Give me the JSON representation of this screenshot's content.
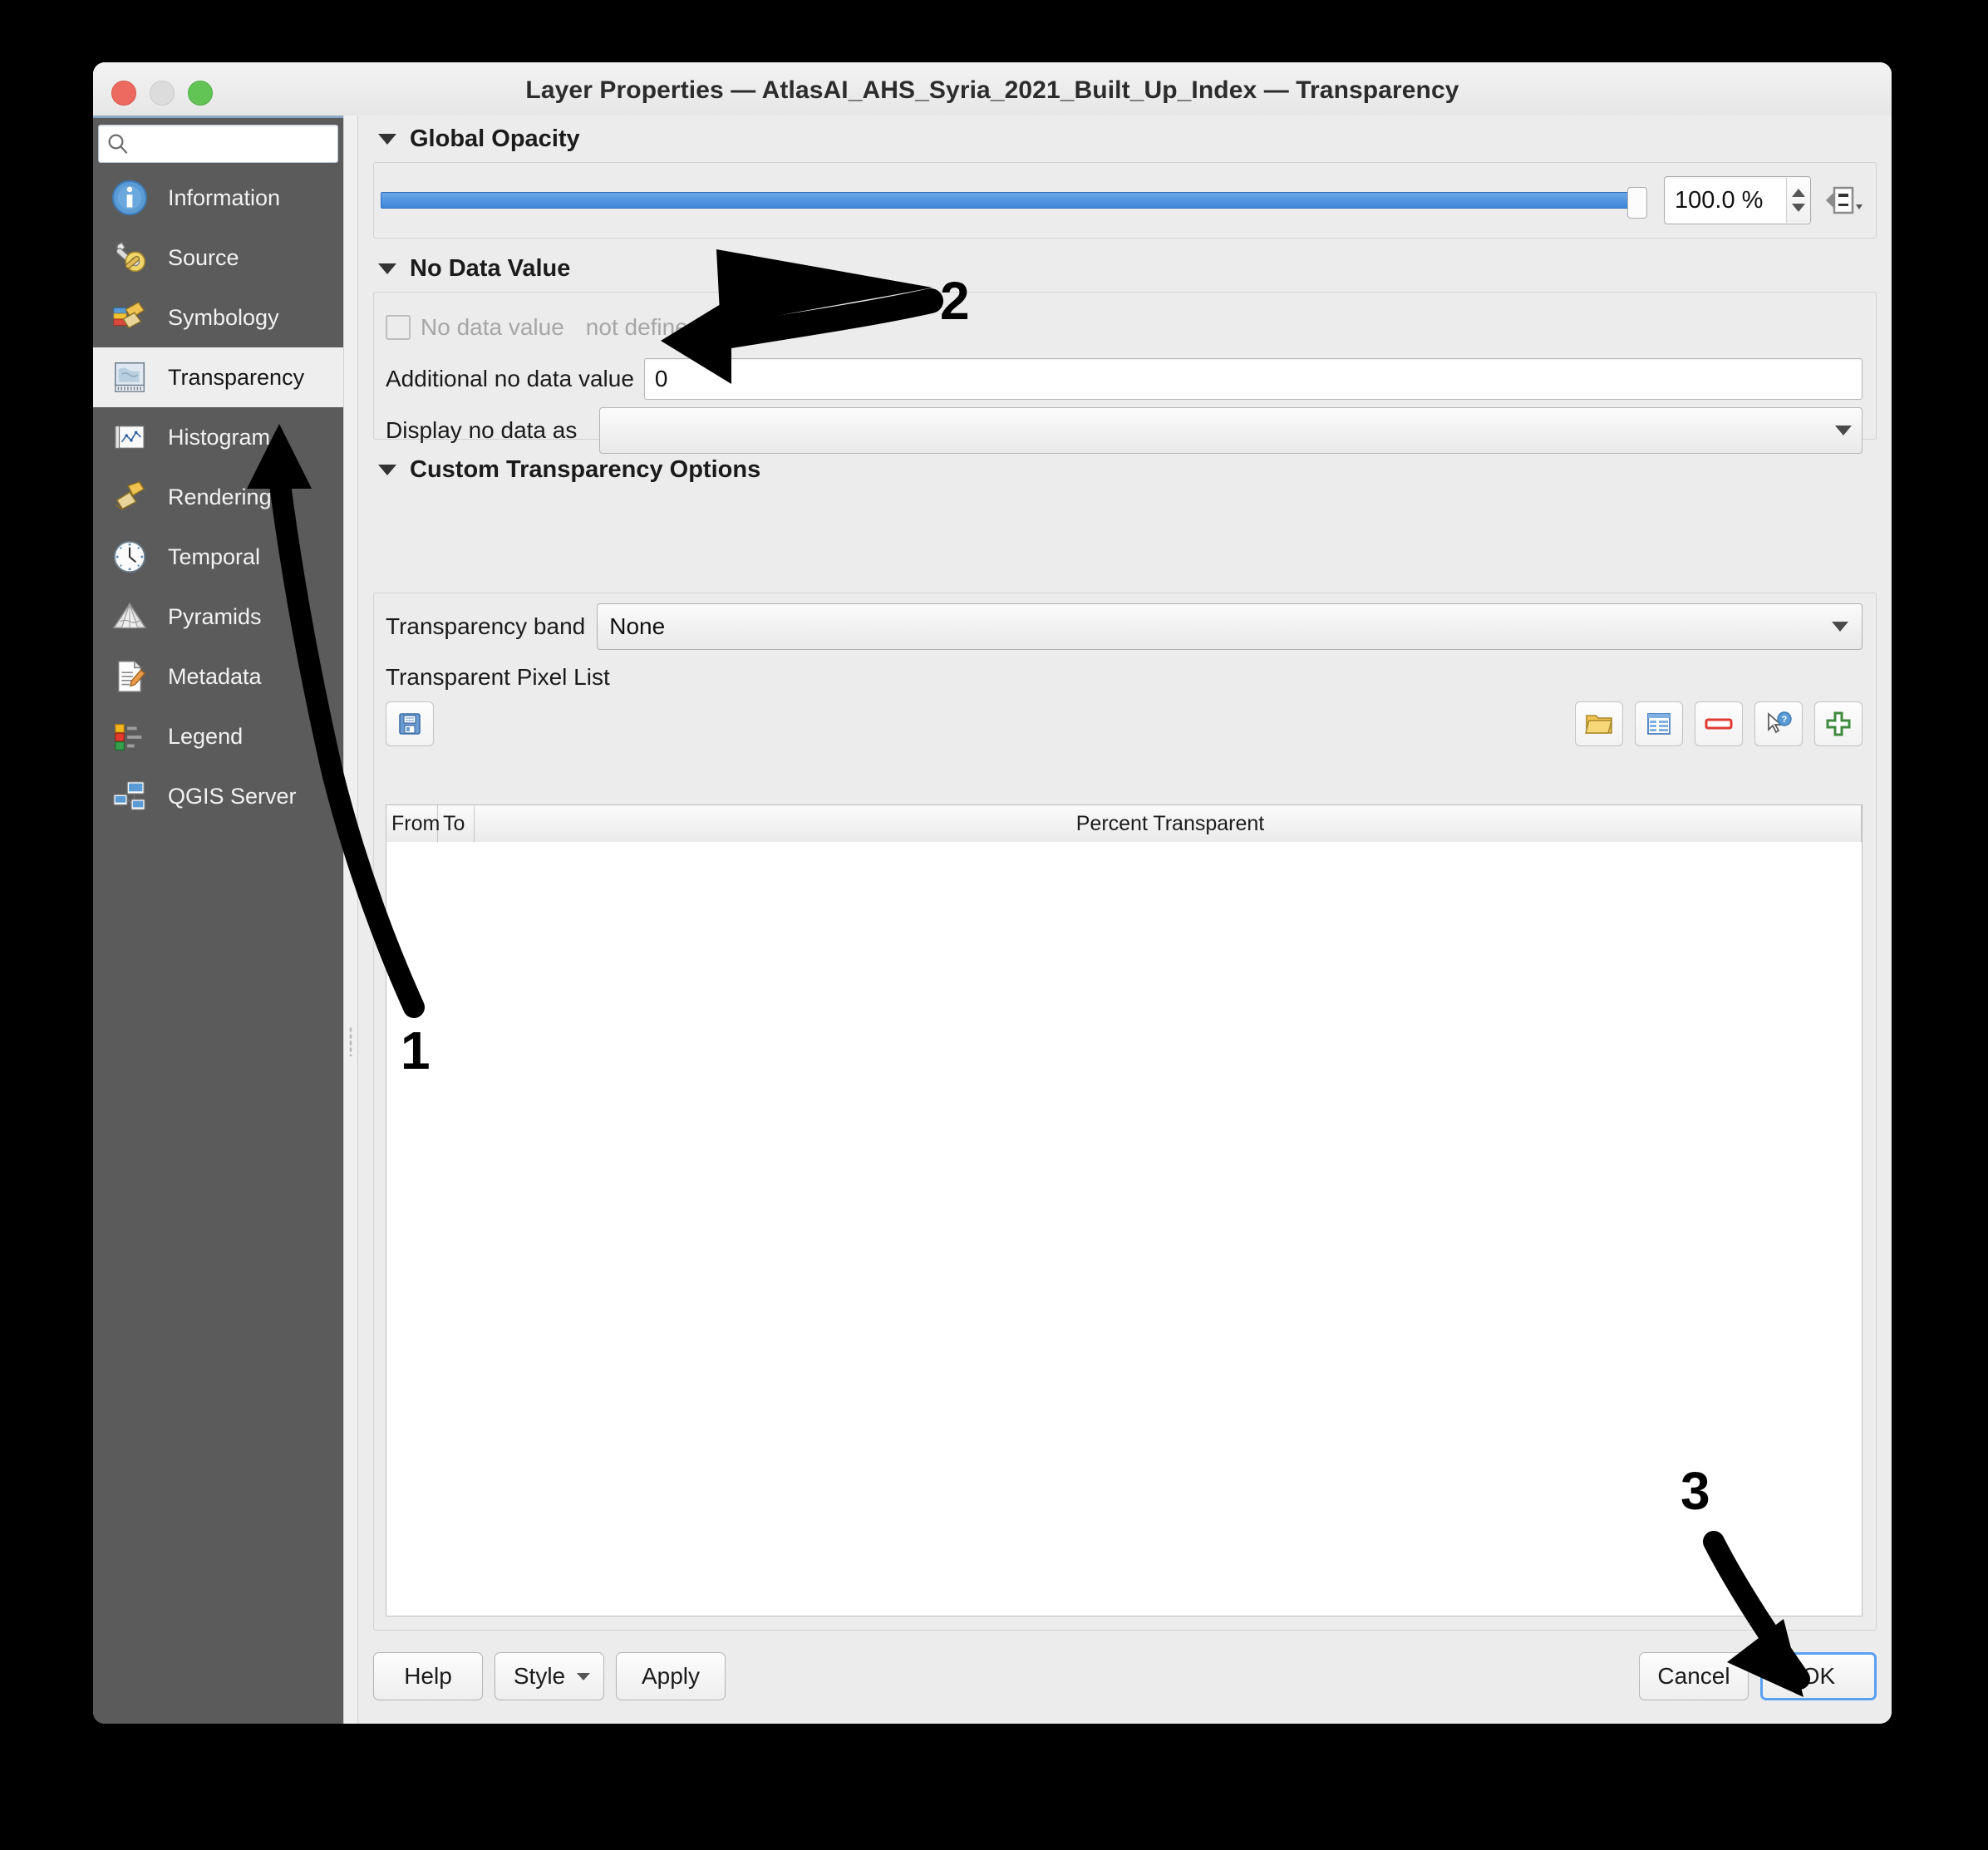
{
  "window": {
    "title": "Layer Properties — AtlasAI_AHS_Syria_2021_Built_Up_Index — Transparency",
    "traffic": {
      "close": "close-button",
      "minimize": "minimize-button",
      "zoom": "zoom-button"
    }
  },
  "sidebar": {
    "search_placeholder": "",
    "search_value": "",
    "items": [
      {
        "label": "Information",
        "icon": "information-icon",
        "active": false
      },
      {
        "label": "Source",
        "icon": "source-icon",
        "active": false
      },
      {
        "label": "Symbology",
        "icon": "symbology-icon",
        "active": false
      },
      {
        "label": "Transparency",
        "icon": "transparency-icon",
        "active": true
      },
      {
        "label": "Histogram",
        "icon": "histogram-icon",
        "active": false
      },
      {
        "label": "Rendering",
        "icon": "rendering-icon",
        "active": false
      },
      {
        "label": "Temporal",
        "icon": "temporal-icon",
        "active": false
      },
      {
        "label": "Pyramids",
        "icon": "pyramids-icon",
        "active": false
      },
      {
        "label": "Metadata",
        "icon": "metadata-icon",
        "active": false
      },
      {
        "label": "Legend",
        "icon": "legend-icon",
        "active": false
      },
      {
        "label": "QGIS Server",
        "icon": "qgis-server-icon",
        "active": false
      }
    ]
  },
  "global_opacity": {
    "section_title": "Global Opacity",
    "value": "100.0 %",
    "slider_percent": 100,
    "data_defined_override": "data-defined-override-button"
  },
  "no_data_value": {
    "section_title": "No Data Value",
    "checkbox_label": "No data value",
    "checkbox_state_text": "not defined",
    "checkbox_checked": false,
    "additional_label": "Additional no data value",
    "additional_value": "0",
    "display_label": "Display no data as",
    "display_value": ""
  },
  "custom_transparency": {
    "section_title": "Custom Transparency Options",
    "band_label": "Transparency band",
    "band_value": "None",
    "pixel_list_label": "Transparent Pixel List",
    "toolbar_left": [
      {
        "name": "export-to-file-icon",
        "tooltip": "Export to file"
      }
    ],
    "toolbar_right": [
      {
        "name": "import-from-file-icon",
        "tooltip": "Import from file"
      },
      {
        "name": "add-values-from-display-icon",
        "tooltip": "Add values from display"
      },
      {
        "name": "remove-selected-row-icon",
        "tooltip": "Remove selected row"
      },
      {
        "name": "add-values-manually-icon",
        "tooltip": "Add values manually"
      },
      {
        "name": "add-values-icon",
        "tooltip": "Add values"
      }
    ],
    "table": {
      "columns": [
        "From",
        "To",
        "Percent Transparent"
      ],
      "rows": []
    }
  },
  "bottom_bar": {
    "help": "Help",
    "style": "Style",
    "apply": "Apply",
    "cancel": "Cancel",
    "ok": "OK"
  },
  "annotations": [
    {
      "number": "1",
      "target": "sidebar-item-transparency"
    },
    {
      "number": "2",
      "target": "additional-no-data-value-input"
    },
    {
      "number": "3",
      "target": "ok-button"
    }
  ],
  "colors": {
    "accent_blue": "#3d86d8",
    "focus_blue": "#5aa0f0",
    "sidebar_bg": "#5b5b5b",
    "panel_bg": "#ececec",
    "close_red": "#ec6a5f",
    "zoom_green": "#61c454"
  }
}
